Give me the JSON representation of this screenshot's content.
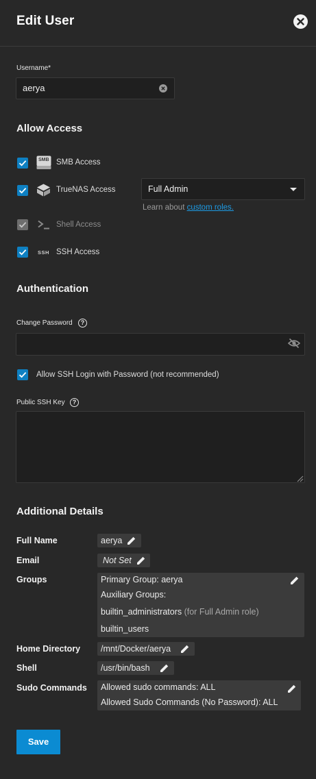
{
  "header": {
    "title": "Edit User"
  },
  "username": {
    "label": "Username",
    "required_mark": "*",
    "value": "aerya"
  },
  "allow_access": {
    "title": "Allow Access",
    "smb": {
      "label": "SMB Access",
      "icon_text": "SMB",
      "checked": true
    },
    "truenas": {
      "label": "TrueNAS Access",
      "checked": true,
      "role_selected": "Full Admin",
      "hint_prefix": "Learn about ",
      "hint_link": "custom roles."
    },
    "shell": {
      "label": "Shell Access",
      "checked": true,
      "disabled": true
    },
    "ssh": {
      "label": "SSH Access",
      "icon_text": "SSH",
      "checked": true
    }
  },
  "authentication": {
    "title": "Authentication",
    "change_password_label": "Change Password",
    "password_value": "",
    "ssh_password_login": {
      "label": "Allow SSH Login with Password (not recommended)",
      "checked": true
    },
    "public_key_label": "Public SSH Key",
    "public_key_value": ""
  },
  "details": {
    "title": "Additional Details",
    "full_name": {
      "label": "Full Name",
      "value": "aerya"
    },
    "email": {
      "label": "Email",
      "value": "Not Set"
    },
    "groups": {
      "label": "Groups",
      "primary": "Primary Group: aerya",
      "auxiliary_title": "Auxiliary Groups:",
      "aux1": "builtin_administrators",
      "aux1_note": "(for Full Admin role)",
      "aux2": "builtin_users"
    },
    "home": {
      "label": "Home Directory",
      "value": "/mnt/Docker/aerya"
    },
    "shell": {
      "label": "Shell",
      "value": "/usr/bin/bash"
    },
    "sudo": {
      "label": "Sudo Commands",
      "line1": "Allowed sudo commands: ALL",
      "line2": "Allowed Sudo Commands (No Password): ALL"
    }
  },
  "actions": {
    "save_label": "Save"
  },
  "colors": {
    "accent": "#0b8bd2",
    "link": "#1d9ce6",
    "background": "#282828"
  }
}
